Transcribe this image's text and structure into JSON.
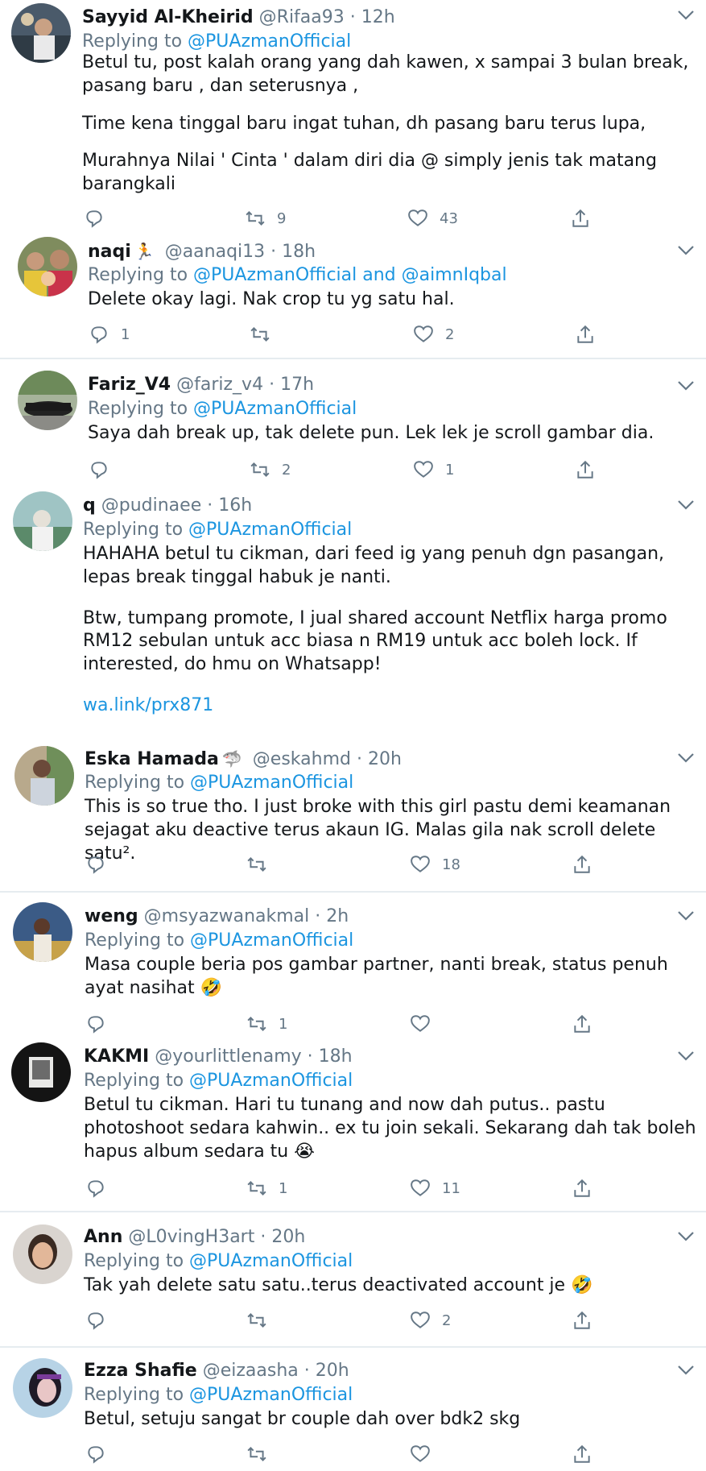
{
  "tweets": [
    {
      "name": "Sayyid Al-Kheirid",
      "handle": "@Rifaa93",
      "time": "12h",
      "replying_label": "Replying to",
      "mentions": [
        "@PUAzmanOfficial"
      ],
      "body": [
        "Betul tu, post kalah orang yang dah kawen, x sampai 3 bulan break, pasang baru , dan seterusnya ,",
        "Time kena tinggal baru ingat tuhan, dh pasang baru terus lupa,",
        "Murahnya Nilai ' Cinta ' dalam diri dia @ simply jenis tak matang barangkali"
      ],
      "replies": "",
      "retweets": "9",
      "likes": "43"
    },
    {
      "name": "naqi",
      "name_emoji": "🏃",
      "handle": "@aanaqi13",
      "time": "18h",
      "replying_label": "Replying to",
      "mentions": [
        "@PUAzmanOfficial",
        "@aimnIqbal"
      ],
      "mention_joiner": "and",
      "body": [
        "Delete okay lagi. Nak crop tu yg satu hal."
      ],
      "replies": "1",
      "retweets": "",
      "likes": "2"
    },
    {
      "name": "Fariz_V4",
      "handle": "@fariz_v4",
      "time": "17h",
      "replying_label": "Replying to",
      "mentions": [
        "@PUAzmanOfficial"
      ],
      "body": [
        "Saya dah break up, tak delete pun. Lek lek je scroll gambar dia."
      ],
      "replies": "",
      "retweets": "2",
      "likes": "1"
    },
    {
      "name": "q",
      "handle": "@pudinaee",
      "time": "16h",
      "replying_label": "Replying to",
      "mentions": [
        "@PUAzmanOfficial"
      ],
      "body": [
        "HAHAHA betul tu cikman, dari feed ig yang penuh dgn pasangan, lepas break tinggal habuk je nanti.",
        "Btw, tumpang promote, I jual shared account Netflix harga promo RM12 sebulan untuk acc biasa n RM19 untuk acc boleh lock. If interested, do hmu on Whatsapp!"
      ],
      "link": "wa.link/prx871"
    },
    {
      "name": "Eska Hamada",
      "name_emoji": "🦈",
      "handle": "@eskahmd",
      "time": "20h",
      "replying_label": "Replying to",
      "mentions": [
        "@PUAzmanOfficial"
      ],
      "body": [
        "This is so true tho. I just broke with this girl pastu demi keamanan sejagat aku deactive terus akaun IG. Malas gila nak scroll delete satu²."
      ],
      "replies": "",
      "retweets": "",
      "likes": "18"
    },
    {
      "name": "weng",
      "handle": "@msyazwanakmal",
      "time": "2h",
      "replying_label": "Replying to",
      "mentions": [
        "@PUAzmanOfficial"
      ],
      "body": [
        "Masa couple beria pos gambar partner, nanti break, status penuh ayat nasihat 🤣"
      ],
      "replies": "",
      "retweets": "1",
      "likes": ""
    },
    {
      "name": "KAKMI",
      "handle": "@yourlittlenamy",
      "time": "18h",
      "replying_label": "Replying to",
      "mentions": [
        "@PUAzmanOfficial"
      ],
      "body": [
        "Betul tu cikman. Hari tu tunang and now dah putus.. pastu photoshoot sedara kahwin.. ex tu join sekali. Sekarang dah tak boleh hapus album sedara tu 😭"
      ],
      "replies": "",
      "retweets": "1",
      "likes": "11"
    },
    {
      "name": "Ann",
      "handle": "@L0vingH3art",
      "time": "20h",
      "replying_label": "Replying to",
      "mentions": [
        "@PUAzmanOfficial"
      ],
      "body": [
        "Tak yah delete satu satu..terus deactivated account je 🤣"
      ],
      "replies": "",
      "retweets": "",
      "likes": "2"
    },
    {
      "name": "Ezza Shafie",
      "handle": "@eizaasha",
      "time": "20h",
      "replying_label": "Replying to",
      "mentions": [
        "@PUAzmanOfficial"
      ],
      "body": [
        "Betul, setuju sangat br couple dah over bdk2 skg"
      ],
      "replies": "",
      "retweets": "",
      "likes": ""
    }
  ],
  "separator_dot": "·",
  "icons": [
    "reply-icon",
    "retweet-icon",
    "like-icon",
    "share-icon",
    "chevron-down-icon"
  ],
  "colors": {
    "link": "#1b95e0",
    "muted": "#657786",
    "text": "#14171a",
    "divider": "#e6ecf0"
  }
}
